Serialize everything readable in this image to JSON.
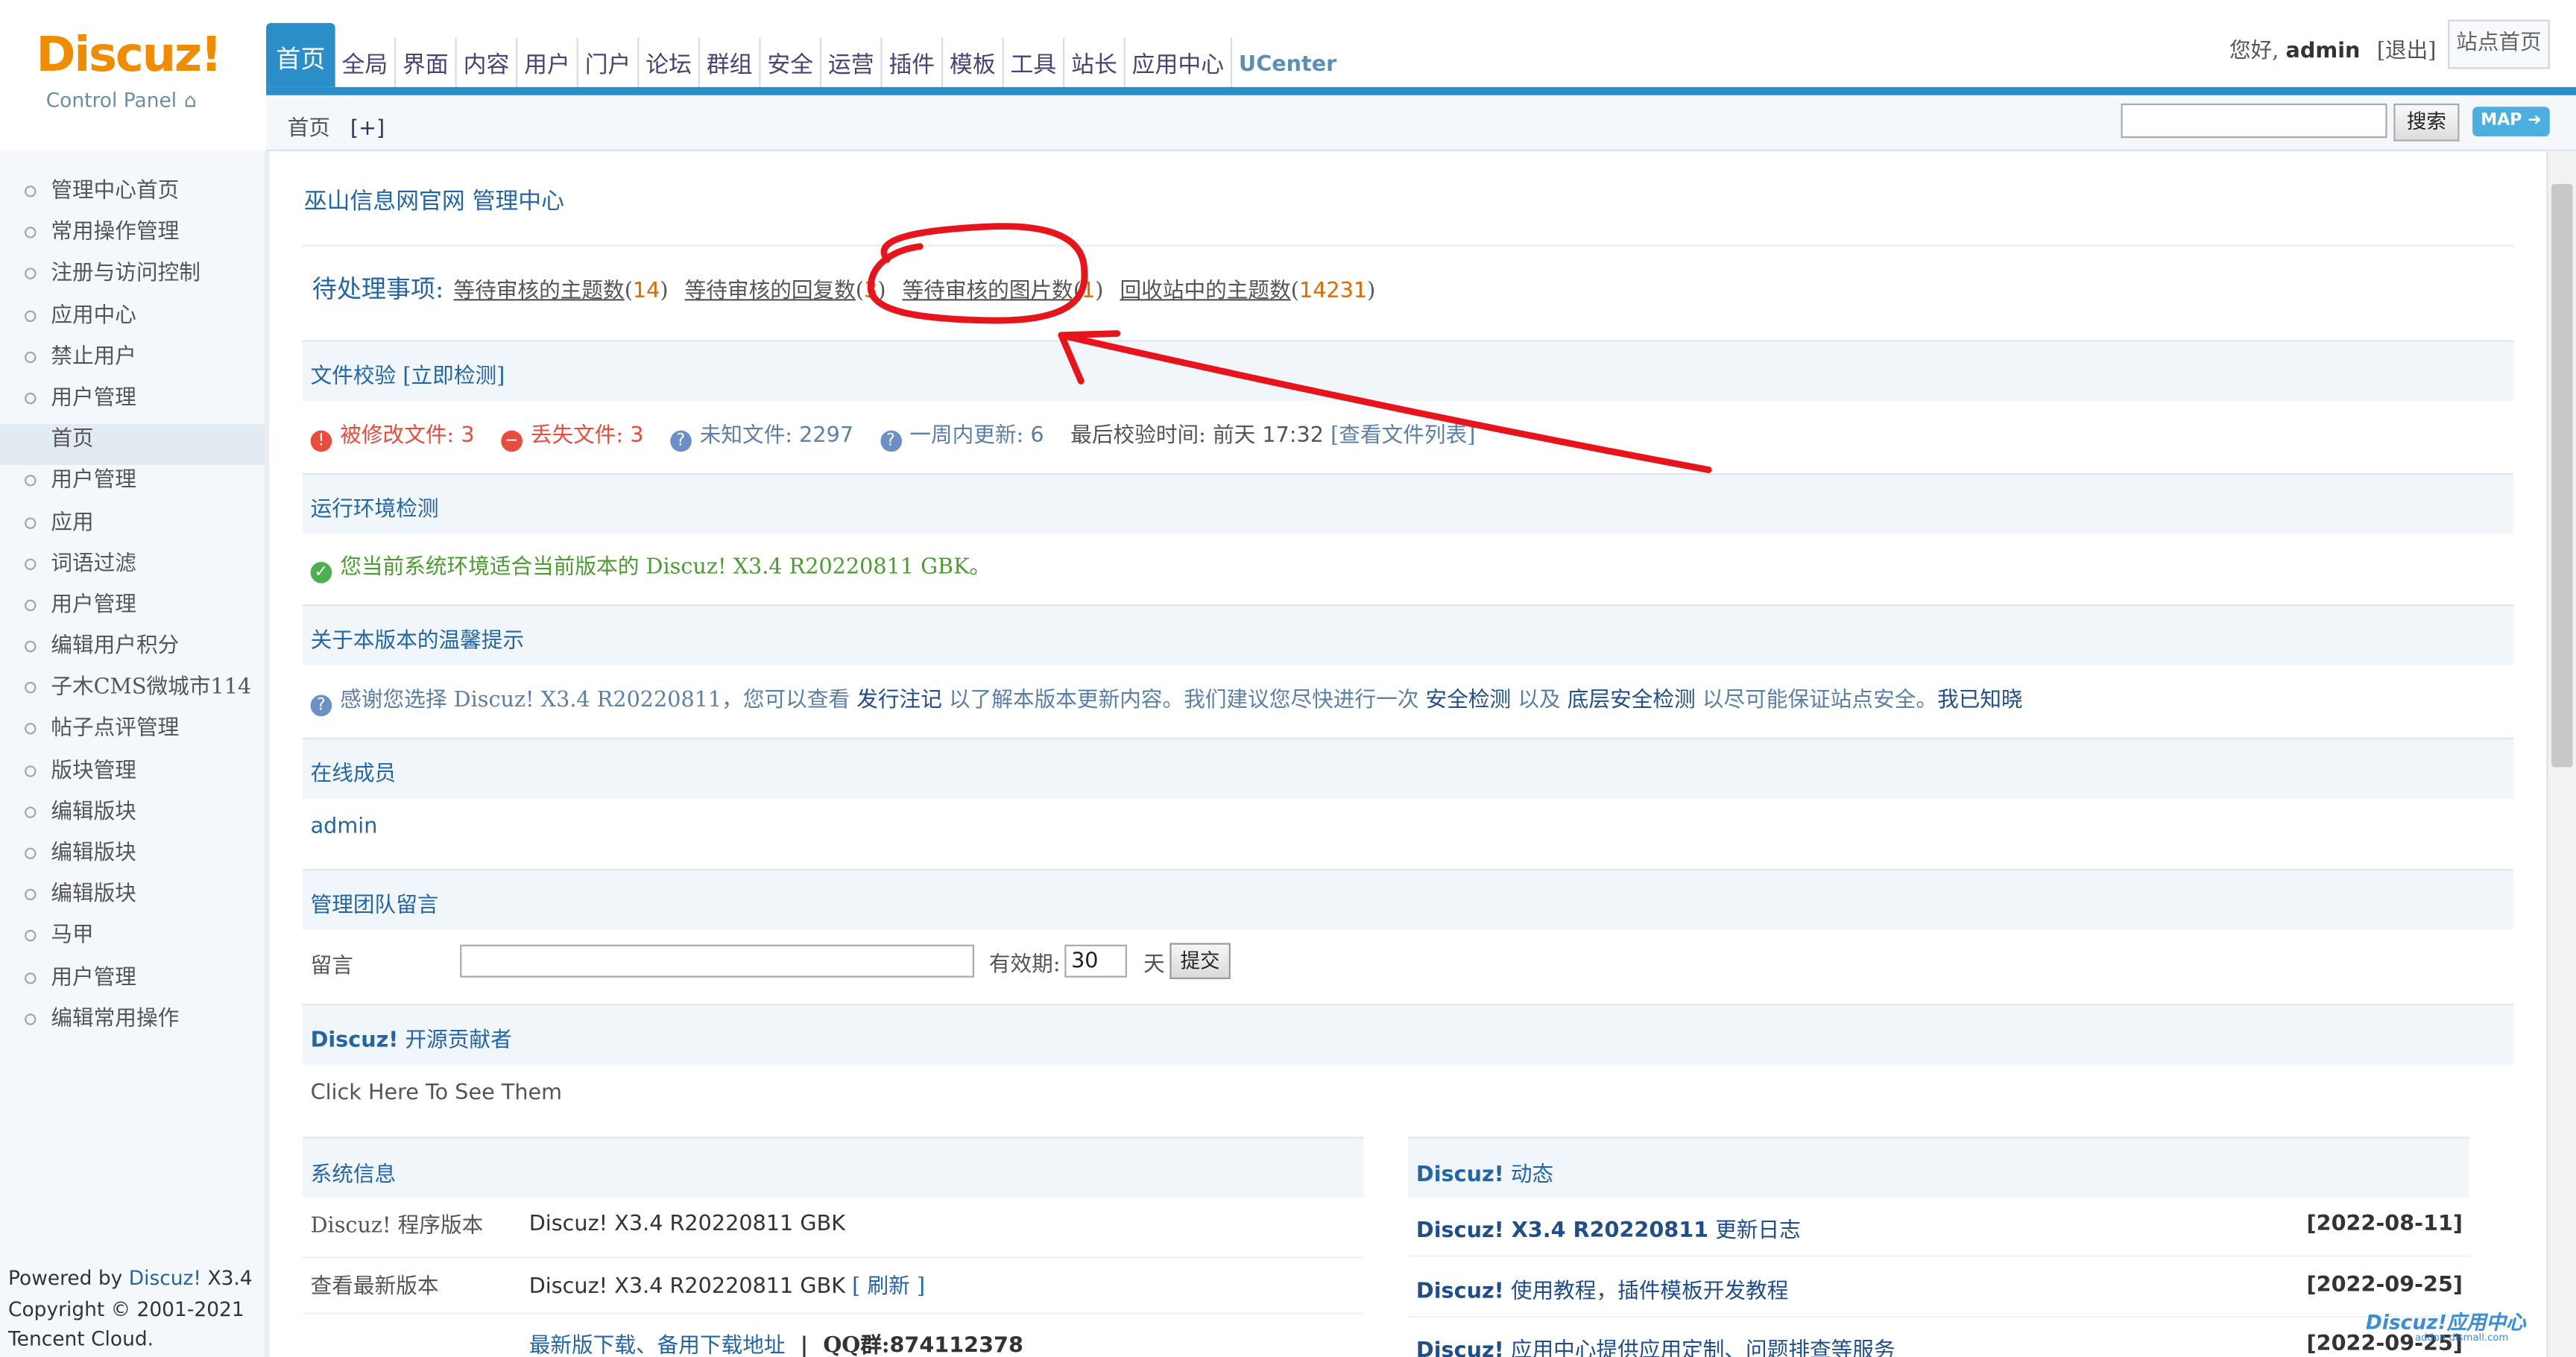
{
  "logo": {
    "wordmark": "Discuz!",
    "sub": "Control Panel"
  },
  "nav": {
    "tabs": [
      "首页",
      "全局",
      "界面",
      "内容",
      "用户",
      "门户",
      "论坛",
      "群组",
      "安全",
      "运营",
      "插件",
      "模板",
      "工具",
      "站长",
      "应用中心",
      "UCenter"
    ],
    "active": "首页"
  },
  "header": {
    "greeting": "您好,",
    "username": "admin",
    "logout": "[退出]",
    "site_home": "站点首页",
    "breadcrumb": "首页",
    "breadcrumb_add": "[+]",
    "search_button": "搜索",
    "map_button": "MAP ➜"
  },
  "sidebar": {
    "items": [
      "管理中心首页",
      "常用操作管理",
      "注册与访问控制",
      "应用中心",
      "禁止用户",
      "用户管理",
      "首页",
      "用户管理",
      "应用",
      "词语过滤",
      "用户管理",
      "编辑用户积分",
      "子木CMS微城市114",
      "帖子点评管理",
      "版块管理",
      "编辑版块",
      "编辑版块",
      "编辑版块",
      "马甲",
      "用户管理",
      "编辑常用操作"
    ],
    "active_index": 6
  },
  "footer": {
    "powered_prefix": "Powered by ",
    "powered_brand": "Discuz!",
    "powered_version": " X3.4",
    "copyright": "Copyright © 2001-2021",
    "company": "Tencent Cloud."
  },
  "main": {
    "site_title": "巫山信息网官网 管理中心",
    "pending": {
      "label": "待处理事项:",
      "items": [
        {
          "text": "等待审核的主题数",
          "count": "14"
        },
        {
          "text": "等待审核的回复数",
          "count": "3"
        },
        {
          "text": "等待审核的图片数",
          "count": "1"
        },
        {
          "text": "回收站中的主题数",
          "count": "14231"
        }
      ]
    },
    "file_check": {
      "title": "文件校验",
      "action": "[立即检测]",
      "modified_label": "被修改文件:",
      "modified_count": "3",
      "missing_label": "丢失文件:",
      "missing_count": "3",
      "unknown_label": "未知文件:",
      "unknown_count": "2297",
      "week_label": "一周内更新:",
      "week_count": "6",
      "last_check_label": "最后校验时间:",
      "last_check_value": "前天 17:32",
      "view_list": "[查看文件列表]"
    },
    "env": {
      "title": "运行环境检测",
      "text": "您当前系统环境适合当前版本的 Discuz! X3.4 R20220811 GBK。"
    },
    "tips": {
      "title": "关于本版本的温馨提示",
      "p1": "感谢您选择 Discuz! X3.4 R20220811，您可以查看",
      "link1": "发行注记",
      "p2": "以了解本版本更新内容。我们建议您尽快进行一次",
      "link2": "安全检测",
      "p3": "以及",
      "link3": "底层安全检测",
      "p4": "以尽可能保证站点安全。",
      "link4": "我已知晓"
    },
    "online": {
      "title": "在线成员",
      "user": "admin"
    },
    "team_msg": {
      "title": "管理团队留言",
      "label": "留言",
      "validity_label": "有效期:",
      "validity_value": "30",
      "unit": "天",
      "submit": "提交"
    },
    "contributors": {
      "title_brand": "Discuz!",
      "title_rest": " 开源贡献者",
      "link": "Click Here To See Them"
    },
    "sysinfo": {
      "title": "系统信息",
      "rows": [
        {
          "label": "Discuz! 程序版本",
          "value": "Discuz! X3.4 R20220811 GBK"
        },
        {
          "label": "查看最新版本",
          "value": "Discuz! X3.4 R20220811 GBK",
          "action": "[ 刷新 ]"
        }
      ],
      "download": "最新版下载、备用下载地址",
      "qq_label": "QQ群:",
      "qq": "874112378"
    },
    "news": {
      "title_brand": "Discuz!",
      "title_rest": " 动态",
      "items": [
        {
          "brand": "Discuz! X3.4 R20220811",
          "text": " 更新日志",
          "date": "[2022-08-11]"
        },
        {
          "brand": "Discuz!",
          "text": " 使用教程，插件模板开发教程",
          "date": "[2022-09-25]"
        },
        {
          "brand": "Discuz!",
          "text": " 应用中心提供应用定制、问题排查等服务",
          "date": "[2022-09-25]"
        }
      ]
    }
  },
  "watermark": {
    "text": "Discuz!应用中心",
    "sub": "addon.dismall.com"
  },
  "colors": {
    "accent": "#2a8fc9",
    "link": "#2366a8",
    "logo": "#f08c00",
    "annotation": "#e8141b"
  }
}
